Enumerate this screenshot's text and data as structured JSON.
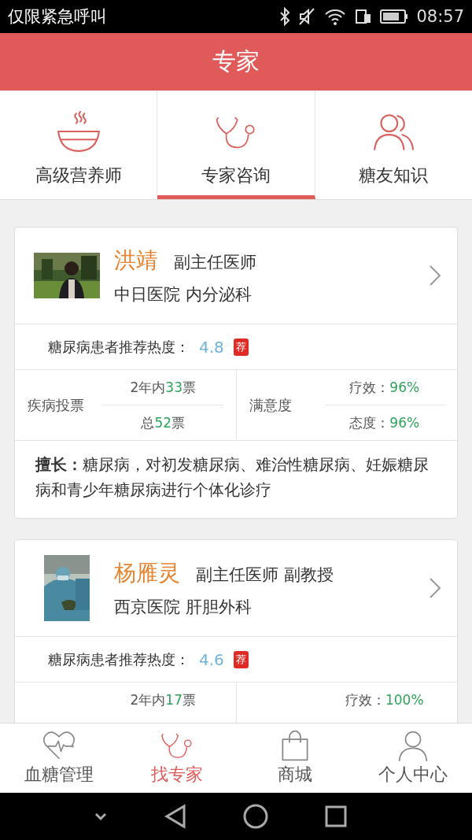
{
  "status_bar": {
    "carrier": "仅限紧急呼叫",
    "time": "08:57"
  },
  "header": {
    "title": "专家"
  },
  "tabs": [
    {
      "label": "高级营养师",
      "selected": false
    },
    {
      "label": "专家咨询",
      "selected": true
    },
    {
      "label": "糖友知识",
      "selected": false
    }
  ],
  "doctors": [
    {
      "name": "洪靖",
      "title": "副主任医师",
      "hospital": "中日医院 内分泌科",
      "rating_label": "糖尿病患者推荐热度：",
      "rating": "4.8",
      "badge": "荐",
      "votes_label": "疾病投票",
      "votes_recent": {
        "prefix": "2年内",
        "count": "33",
        "suffix": "票"
      },
      "votes_total": {
        "prefix": "总",
        "count": "52",
        "suffix": "票"
      },
      "satisfaction_label": "满意度",
      "effect": {
        "label": "疗效：",
        "value": "96%"
      },
      "attitude": {
        "label": "态度：",
        "value": "96%"
      },
      "expertise": "**擅长：**糖尿病，对初发糖尿病、难治性糖尿病、妊娠糖尿病和青少年糖尿病进行个体化诊疗"
    },
    {
      "name": "杨雁灵",
      "title": "副主任医师 副教授",
      "hospital": "西京医院 肝胆外科",
      "rating_label": "糖尿病患者推荐热度：",
      "rating": "4.6",
      "badge": "荐",
      "votes_recent": {
        "prefix": "2年内",
        "count": "17",
        "suffix": "票"
      },
      "effect": {
        "label": "疗效：",
        "value": "100%"
      }
    }
  ],
  "bottom_nav": [
    {
      "label": "血糖管理",
      "selected": false
    },
    {
      "label": "找专家",
      "selected": true
    },
    {
      "label": "商城",
      "selected": false
    },
    {
      "label": "个人中心",
      "selected": false
    }
  ]
}
